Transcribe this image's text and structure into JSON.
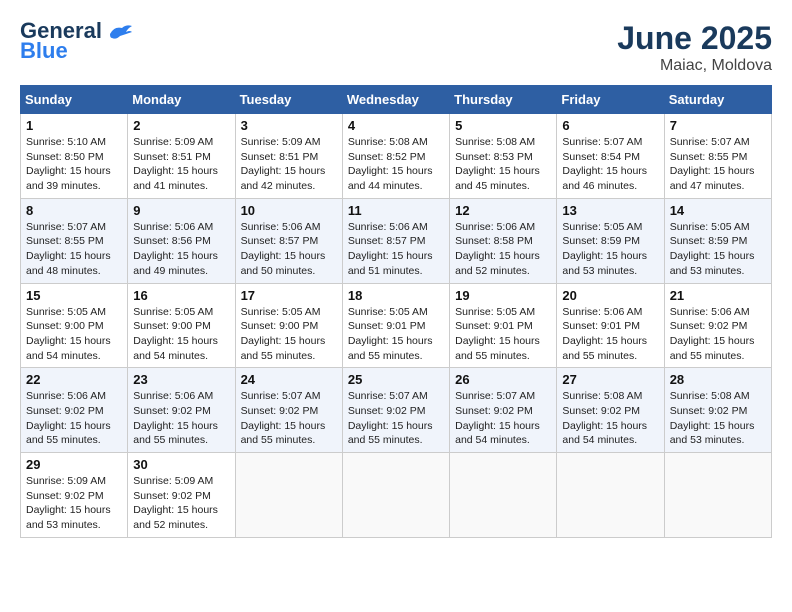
{
  "header": {
    "logo_general": "General",
    "logo_blue": "Blue",
    "month": "June 2025",
    "location": "Maiac, Moldova"
  },
  "weekdays": [
    "Sunday",
    "Monday",
    "Tuesday",
    "Wednesday",
    "Thursday",
    "Friday",
    "Saturday"
  ],
  "weeks": [
    [
      {
        "day": "1",
        "info": "Sunrise: 5:10 AM\nSunset: 8:50 PM\nDaylight: 15 hours\nand 39 minutes."
      },
      {
        "day": "2",
        "info": "Sunrise: 5:09 AM\nSunset: 8:51 PM\nDaylight: 15 hours\nand 41 minutes."
      },
      {
        "day": "3",
        "info": "Sunrise: 5:09 AM\nSunset: 8:51 PM\nDaylight: 15 hours\nand 42 minutes."
      },
      {
        "day": "4",
        "info": "Sunrise: 5:08 AM\nSunset: 8:52 PM\nDaylight: 15 hours\nand 44 minutes."
      },
      {
        "day": "5",
        "info": "Sunrise: 5:08 AM\nSunset: 8:53 PM\nDaylight: 15 hours\nand 45 minutes."
      },
      {
        "day": "6",
        "info": "Sunrise: 5:07 AM\nSunset: 8:54 PM\nDaylight: 15 hours\nand 46 minutes."
      },
      {
        "day": "7",
        "info": "Sunrise: 5:07 AM\nSunset: 8:55 PM\nDaylight: 15 hours\nand 47 minutes."
      }
    ],
    [
      {
        "day": "8",
        "info": "Sunrise: 5:07 AM\nSunset: 8:55 PM\nDaylight: 15 hours\nand 48 minutes."
      },
      {
        "day": "9",
        "info": "Sunrise: 5:06 AM\nSunset: 8:56 PM\nDaylight: 15 hours\nand 49 minutes."
      },
      {
        "day": "10",
        "info": "Sunrise: 5:06 AM\nSunset: 8:57 PM\nDaylight: 15 hours\nand 50 minutes."
      },
      {
        "day": "11",
        "info": "Sunrise: 5:06 AM\nSunset: 8:57 PM\nDaylight: 15 hours\nand 51 minutes."
      },
      {
        "day": "12",
        "info": "Sunrise: 5:06 AM\nSunset: 8:58 PM\nDaylight: 15 hours\nand 52 minutes."
      },
      {
        "day": "13",
        "info": "Sunrise: 5:05 AM\nSunset: 8:59 PM\nDaylight: 15 hours\nand 53 minutes."
      },
      {
        "day": "14",
        "info": "Sunrise: 5:05 AM\nSunset: 8:59 PM\nDaylight: 15 hours\nand 53 minutes."
      }
    ],
    [
      {
        "day": "15",
        "info": "Sunrise: 5:05 AM\nSunset: 9:00 PM\nDaylight: 15 hours\nand 54 minutes."
      },
      {
        "day": "16",
        "info": "Sunrise: 5:05 AM\nSunset: 9:00 PM\nDaylight: 15 hours\nand 54 minutes."
      },
      {
        "day": "17",
        "info": "Sunrise: 5:05 AM\nSunset: 9:00 PM\nDaylight: 15 hours\nand 55 minutes."
      },
      {
        "day": "18",
        "info": "Sunrise: 5:05 AM\nSunset: 9:01 PM\nDaylight: 15 hours\nand 55 minutes."
      },
      {
        "day": "19",
        "info": "Sunrise: 5:05 AM\nSunset: 9:01 PM\nDaylight: 15 hours\nand 55 minutes."
      },
      {
        "day": "20",
        "info": "Sunrise: 5:06 AM\nSunset: 9:01 PM\nDaylight: 15 hours\nand 55 minutes."
      },
      {
        "day": "21",
        "info": "Sunrise: 5:06 AM\nSunset: 9:02 PM\nDaylight: 15 hours\nand 55 minutes."
      }
    ],
    [
      {
        "day": "22",
        "info": "Sunrise: 5:06 AM\nSunset: 9:02 PM\nDaylight: 15 hours\nand 55 minutes."
      },
      {
        "day": "23",
        "info": "Sunrise: 5:06 AM\nSunset: 9:02 PM\nDaylight: 15 hours\nand 55 minutes."
      },
      {
        "day": "24",
        "info": "Sunrise: 5:07 AM\nSunset: 9:02 PM\nDaylight: 15 hours\nand 55 minutes."
      },
      {
        "day": "25",
        "info": "Sunrise: 5:07 AM\nSunset: 9:02 PM\nDaylight: 15 hours\nand 55 minutes."
      },
      {
        "day": "26",
        "info": "Sunrise: 5:07 AM\nSunset: 9:02 PM\nDaylight: 15 hours\nand 54 minutes."
      },
      {
        "day": "27",
        "info": "Sunrise: 5:08 AM\nSunset: 9:02 PM\nDaylight: 15 hours\nand 54 minutes."
      },
      {
        "day": "28",
        "info": "Sunrise: 5:08 AM\nSunset: 9:02 PM\nDaylight: 15 hours\nand 53 minutes."
      }
    ],
    [
      {
        "day": "29",
        "info": "Sunrise: 5:09 AM\nSunset: 9:02 PM\nDaylight: 15 hours\nand 53 minutes."
      },
      {
        "day": "30",
        "info": "Sunrise: 5:09 AM\nSunset: 9:02 PM\nDaylight: 15 hours\nand 52 minutes."
      },
      {
        "day": "",
        "info": ""
      },
      {
        "day": "",
        "info": ""
      },
      {
        "day": "",
        "info": ""
      },
      {
        "day": "",
        "info": ""
      },
      {
        "day": "",
        "info": ""
      }
    ]
  ]
}
